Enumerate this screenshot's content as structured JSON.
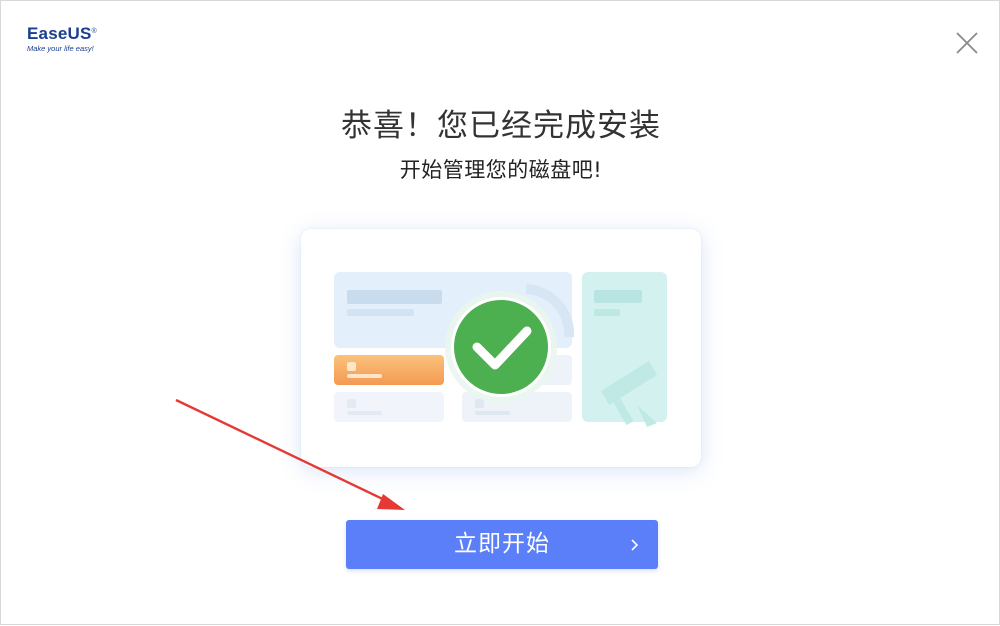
{
  "app": {
    "logo_brand_main": "Ease",
    "logo_brand_accent": "US",
    "logo_registered": "®",
    "logo_tagline": "Make your life easy!"
  },
  "header": {
    "title": "恭喜！您已经完成安装",
    "subtitle": "开始管理您的磁盘吧!"
  },
  "actions": {
    "start_label": "立即开始"
  },
  "icons": {
    "close": "close-icon",
    "chevron": "chevron-right-icon",
    "success": "checkmark-icon"
  },
  "colors": {
    "primary_button": "#5b7ff8",
    "success_green": "#4caf50",
    "annotation_arrow": "#e53935",
    "brand": "#1b3f8f"
  }
}
